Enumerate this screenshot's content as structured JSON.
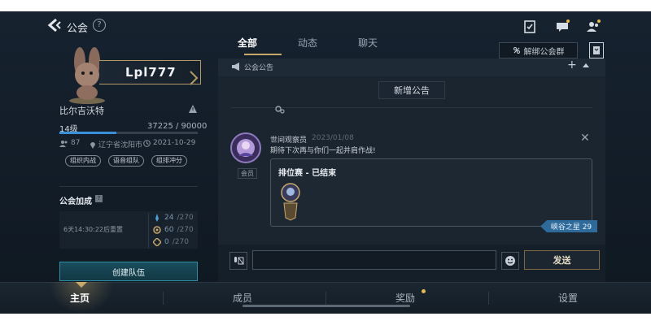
{
  "topbar": {
    "title": "公会",
    "help_label": "?"
  },
  "tabs": [
    {
      "label": "全部"
    },
    {
      "label": "动态"
    },
    {
      "label": "聊天"
    }
  ],
  "header_actions": {
    "bind_group_label": "解绑公会群"
  },
  "profile": {
    "nameplate": "Lpl777",
    "player_name": "比尔吉沃特",
    "level": "14级",
    "xp": "37225 / 90000",
    "xp_progress": 0.4136,
    "members": "87",
    "location": "辽宁省沈阳市",
    "created": "2021-10-29",
    "tags": [
      "组织内战",
      "语音组队",
      "组排冲分"
    ]
  },
  "guild_bonus": {
    "title": "公会加成",
    "help": "?",
    "reset_text": "6天14:30:22后重置",
    "rows": [
      {
        "value": "24",
        "max": "/270"
      },
      {
        "value": "60",
        "max": "/270"
      },
      {
        "value": "0",
        "max": "/270"
      }
    ]
  },
  "create_team_label": "创建队伍",
  "announcement": {
    "title": "公会公告",
    "new_label": "新增公告"
  },
  "message": {
    "sender": "世间观察员",
    "date": "2023/01/08",
    "text": "期待下次再与你们一起并肩作战!",
    "role": "会员",
    "card_title": "排位赛 - 已结束",
    "rank_tag": "峡谷之星 29"
  },
  "chat": {
    "send_label": "发送",
    "input_placeholder": ""
  },
  "bottom_nav": [
    {
      "label": "主页"
    },
    {
      "label": "成员"
    },
    {
      "label": "奖励"
    },
    {
      "label": "设置"
    }
  ],
  "colors": {
    "accent_gold": "#c9a96a",
    "xp_blue": "#3a8fd9",
    "teal_button": "#2c8fa8"
  }
}
